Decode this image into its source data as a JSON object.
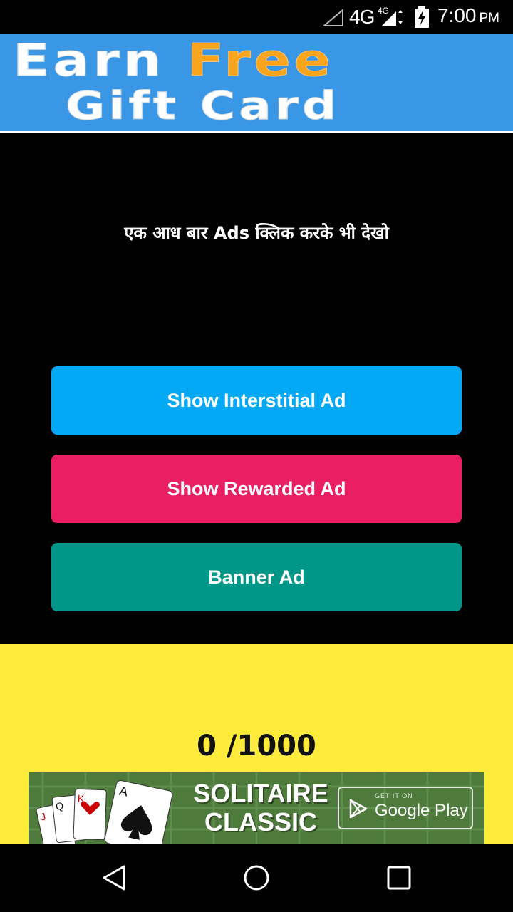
{
  "status_bar": {
    "network": "4G",
    "network_small": "4G",
    "time": "7:00",
    "ampm": "PM",
    "icons": [
      "signal-icon",
      "signal-icon",
      "battery-charging-icon"
    ]
  },
  "header_banner": {
    "line1_word1": "Earn",
    "line1_word2": "Free",
    "line2": "Gift Card",
    "colors": {
      "background": "#3a97e6",
      "accent": "#f8a51d"
    }
  },
  "message": "एक आध बार Ads क्लिक करके भी देखो",
  "buttons": {
    "interstitial": "Show Interstitial Ad",
    "rewarded": "Show Rewarded Ad",
    "banner": "Banner Ad",
    "colors": {
      "interstitial": "#03a9f4",
      "rewarded": "#e91e63",
      "banner": "#009688"
    }
  },
  "counter": "0 /1000",
  "ad_banner": {
    "title_line1": "SOLITAIRE",
    "title_line2": "CLASSIC",
    "store_small": "GET IT ON",
    "store_label": "Google Play"
  },
  "nav_bar": {
    "icons": [
      "back-icon",
      "home-icon",
      "recents-icon"
    ]
  }
}
